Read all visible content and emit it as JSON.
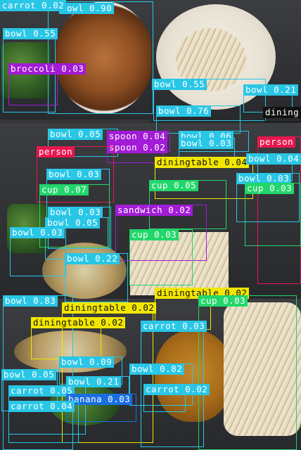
{
  "detections": [
    {
      "label": "bowl",
      "score": "0.90",
      "color": "#29c6e6"
    },
    {
      "label": "bowl",
      "score": "0.55",
      "color": "#29c6e6"
    },
    {
      "label": "broccoli",
      "score": "0.03",
      "color": "#a21bd6"
    },
    {
      "label": "bowl",
      "score": "0.55",
      "color": "#29c6e6"
    },
    {
      "label": "bowl",
      "score": "0.21",
      "color": "#29c6e6"
    },
    {
      "label": "bowl",
      "score": "0.76",
      "color": "#29c6e6"
    },
    {
      "label": "dining",
      "score": "",
      "color": "#111111"
    },
    {
      "label": "bowl",
      "score": "0.05",
      "color": "#29c6e6"
    },
    {
      "label": "spoon",
      "score": "0.04",
      "color": "#a21bd6"
    },
    {
      "label": "spoon",
      "score": "0.02",
      "color": "#a21bd6"
    },
    {
      "label": "bowl",
      "score": "0.06",
      "color": "#29c6e6"
    },
    {
      "label": "bowl",
      "score": "0.03",
      "color": "#29c6e6"
    },
    {
      "label": "person",
      "score": "",
      "color": "#e8174e"
    },
    {
      "label": "person",
      "score": "",
      "color": "#e8174e"
    },
    {
      "label": "diningtable",
      "score": "0.04",
      "color": "#f2e600"
    },
    {
      "label": "bowl",
      "score": "0.04",
      "color": "#29c6e6"
    },
    {
      "label": "bowl",
      "score": "0.03",
      "color": "#29c6e6"
    },
    {
      "label": "bowl",
      "score": "0.03",
      "color": "#29c6e6"
    },
    {
      "label": "cup",
      "score": "0.07",
      "color": "#22d66b"
    },
    {
      "label": "cup",
      "score": "0.05",
      "color": "#22d66b"
    },
    {
      "label": "cup",
      "score": "0.03",
      "color": "#22d66b"
    },
    {
      "label": "bowl",
      "score": "0.03",
      "color": "#29c6e6"
    },
    {
      "label": "sandwich",
      "score": "0.02",
      "color": "#a21bd6"
    },
    {
      "label": "bowl",
      "score": "0.05",
      "color": "#29c6e6"
    },
    {
      "label": "bowl",
      "score": "0.03",
      "color": "#29c6e6"
    },
    {
      "label": "cup",
      "score": "0.03",
      "color": "#22d66b"
    },
    {
      "label": "bowl",
      "score": "0.22",
      "color": "#29c6e6"
    },
    {
      "label": "bowl",
      "score": "0.83",
      "color": "#29c6e6"
    },
    {
      "label": "diningtable",
      "score": "0.02",
      "color": "#f2e600"
    },
    {
      "label": "cup",
      "score": "0.03",
      "color": "#22d66b"
    },
    {
      "label": "diningtable",
      "score": "0.02",
      "color": "#f2e600"
    },
    {
      "label": "diningtable",
      "score": "0.02",
      "color": "#f2e600"
    },
    {
      "label": "carrot",
      "score": "0.03",
      "color": "#29c6e6"
    },
    {
      "label": "bowl",
      "score": "0.09",
      "color": "#29c6e6"
    },
    {
      "label": "bowl",
      "score": "0.82",
      "color": "#29c6e6"
    },
    {
      "label": "bowl",
      "score": "0.05",
      "color": "#29c6e6"
    },
    {
      "label": "bowl",
      "score": "0.21",
      "color": "#29c6e6"
    },
    {
      "label": "carrot",
      "score": "0.02",
      "color": "#29c6e6"
    },
    {
      "label": "carrot",
      "score": "0.05",
      "color": "#29c6e6"
    },
    {
      "label": "banana",
      "score": "0.03",
      "color": "#1a6fe0"
    },
    {
      "label": "carrot",
      "score": "0.04",
      "color": "#29c6e6"
    },
    {
      "label": "carrot",
      "score": "0.02",
      "color": "#29c6e6"
    }
  ]
}
